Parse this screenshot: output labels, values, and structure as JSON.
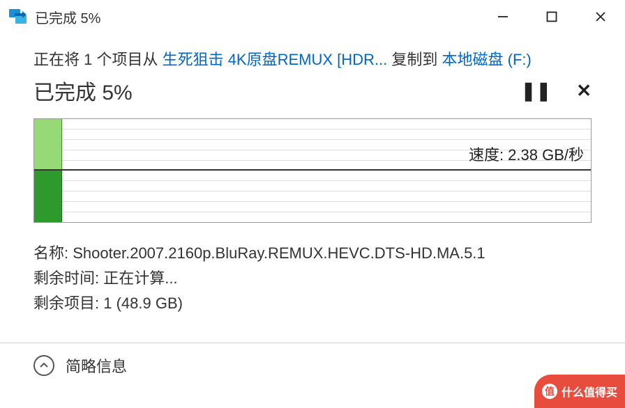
{
  "titlebar": {
    "title": "已完成 5%"
  },
  "copy_line": {
    "prefix": "正在将 1 个项目从 ",
    "source": "生死狙击 4K原盘REMUX [HDR...",
    "middle": " 复制到 ",
    "target": "本地磁盘 (F:)"
  },
  "status": {
    "text": "已完成 5%",
    "pause_glyph": "❚❚",
    "cancel_glyph": "✕"
  },
  "chart_data": {
    "type": "bar",
    "progress_percent": 5,
    "speed_label": "速度: 2.38 GB/秒",
    "colors": {
      "light": "#97d977",
      "dark": "#2e9a2e"
    }
  },
  "details": {
    "name_label": "名称:",
    "name_value": "Shooter.2007.2160p.BluRay.REMUX.HEVC.DTS-HD.MA.5.1",
    "time_label": "剩余时间:",
    "time_value": "正在计算...",
    "items_label": "剩余项目:",
    "items_value": "1 (48.9 GB)"
  },
  "footer": {
    "toggle_label": "简略信息"
  },
  "watermark": {
    "text": "什么值得买",
    "icon_glyph": "值"
  }
}
